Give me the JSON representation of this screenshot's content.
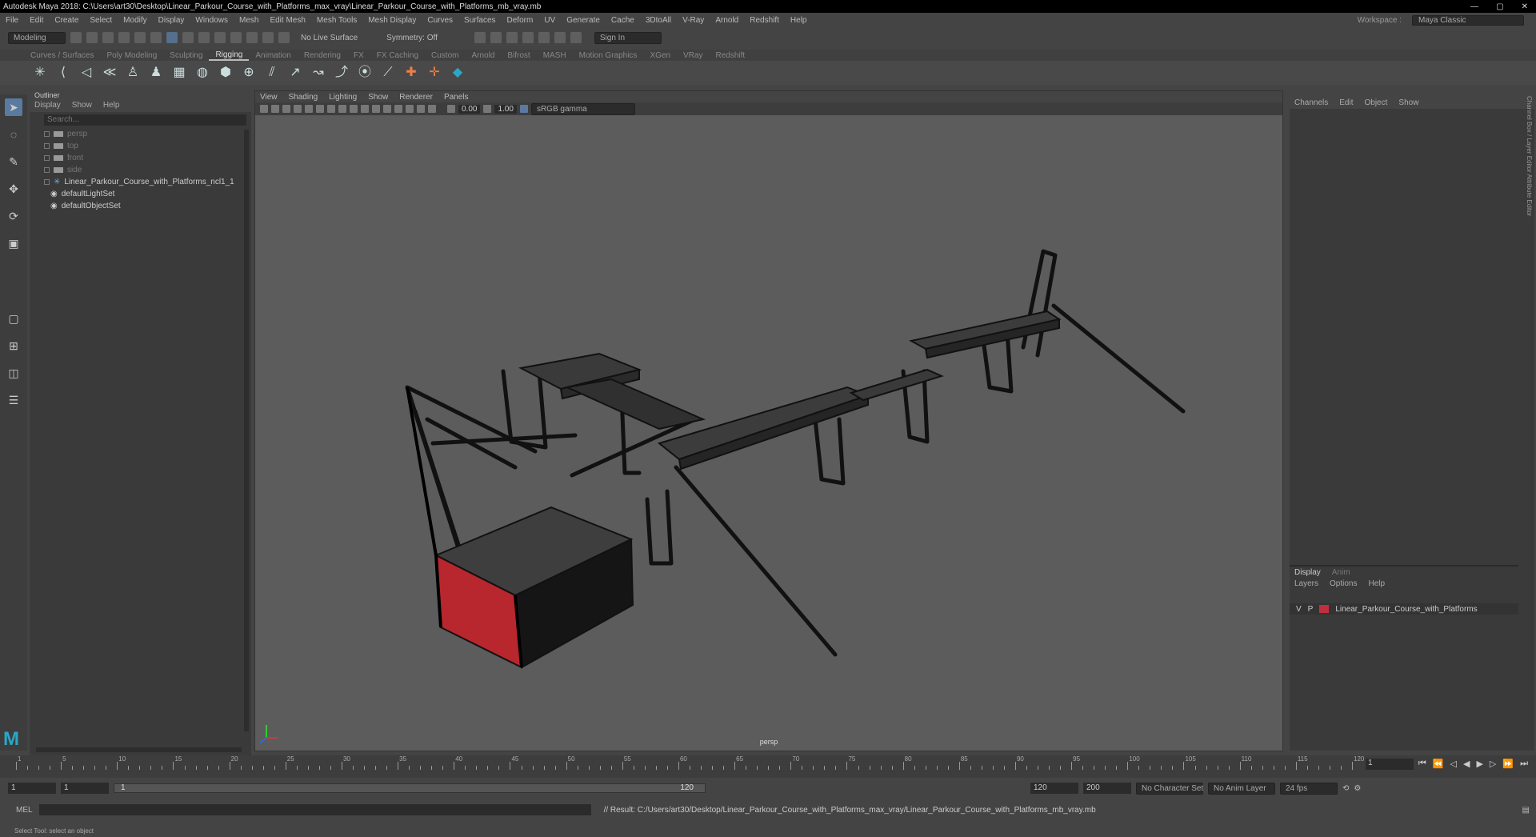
{
  "title": "Autodesk Maya 2018: C:\\Users\\art30\\Desktop\\Linear_Parkour_Course_with_Platforms_max_vray\\Linear_Parkour_Course_with_Platforms_mb_vray.mb",
  "menu": [
    "File",
    "Edit",
    "Create",
    "Select",
    "Modify",
    "Display",
    "Windows",
    "Mesh",
    "Edit Mesh",
    "Mesh Tools",
    "Mesh Display",
    "Curves",
    "Surfaces",
    "Deform",
    "UV",
    "Generate",
    "Cache",
    "3DtoAll",
    "V-Ray",
    "Arnold",
    "Redshift",
    "Help"
  ],
  "workspace": {
    "label": "Workspace :",
    "value": "Maya Classic"
  },
  "status": {
    "mode": "Modeling",
    "live": "No Live Surface",
    "symmetry": "Symmetry: Off",
    "signin": "Sign In"
  },
  "shelf_tabs": [
    "Curves / Surfaces",
    "Poly Modeling",
    "Sculpting",
    "Rigging",
    "Animation",
    "Rendering",
    "FX",
    "FX Caching",
    "Custom",
    "Arnold",
    "Bifrost",
    "MASH",
    "Motion Graphics",
    "XGen",
    "VRay",
    "Redshift"
  ],
  "shelf_active": "Rigging",
  "outliner": {
    "title": "Outliner",
    "menu": [
      "Display",
      "Show",
      "Help"
    ],
    "search": "Search...",
    "items": [
      {
        "label": "persp",
        "dim": true
      },
      {
        "label": "top",
        "dim": true
      },
      {
        "label": "front",
        "dim": true
      },
      {
        "label": "side",
        "dim": true
      },
      {
        "label": "Linear_Parkour_Course_with_Platforms_ncl1_1",
        "dim": false
      },
      {
        "label": "defaultLightSet",
        "dim": false
      },
      {
        "label": "defaultObjectSet",
        "dim": false
      }
    ]
  },
  "viewport": {
    "menu": [
      "View",
      "Shading",
      "Lighting",
      "Show",
      "Renderer",
      "Panels"
    ],
    "value1": "0.00",
    "value2": "1.00",
    "colorspace": "sRGB gamma",
    "camera": "persp"
  },
  "channels": {
    "menu": [
      "Channels",
      "Edit",
      "Object",
      "Show"
    ]
  },
  "layers": {
    "tabs": [
      "Display",
      "Anim"
    ],
    "menu": [
      "Layers",
      "Options",
      "Help"
    ],
    "row": {
      "v": "V",
      "p": "P",
      "name": "Linear_Parkour_Course_with_Platforms",
      "color": "#c0303c"
    }
  },
  "side_tabs": "Channel Box / Layer Editor   Attribute Editor",
  "timeline": {
    "labels": [
      "1",
      "5",
      "10",
      "15",
      "20",
      "25",
      "30",
      "35",
      "40",
      "45",
      "50",
      "55",
      "60",
      "65",
      "70",
      "75",
      "80",
      "85",
      "90",
      "95",
      "100",
      "105",
      "110",
      "115",
      "120"
    ],
    "current": "1"
  },
  "range": {
    "start": "1",
    "start2": "1",
    "slider_left": "1",
    "slider_right": "120",
    "end": "120",
    "end2": "200",
    "charset": "No Character Set",
    "animlayer": "No Anim Layer",
    "fps": "24 fps"
  },
  "mel": {
    "label": "MEL",
    "result": "// Result: C:/Users/art30/Desktop/Linear_Parkour_Course_with_Platforms_max_vray/Linear_Parkour_Course_with_Platforms_mb_vray.mb"
  },
  "help": "Select Tool: select an object"
}
